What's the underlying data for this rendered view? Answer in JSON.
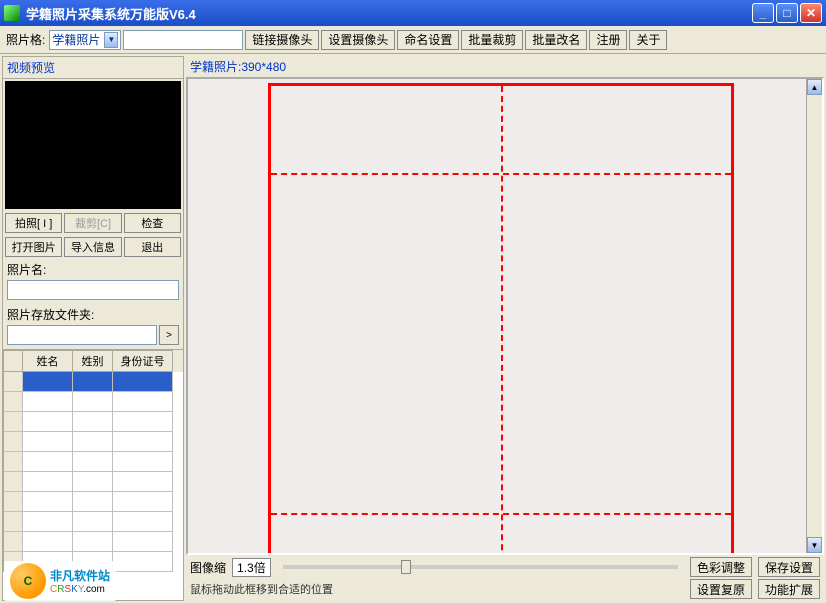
{
  "window": {
    "title": "学籍照片采集系统万能版V6.4"
  },
  "toolbar": {
    "format_label": "照片格:",
    "format_value": "学籍照片",
    "connect_cam": "链接摄像头",
    "set_cam": "设置摄像头",
    "name_set": "命名设置",
    "batch_crop": "批量裁剪",
    "batch_rename": "批量改名",
    "register": "注册",
    "about": "关于"
  },
  "left": {
    "preview_title": "视频预览",
    "btn_capture": "拍照[ I ]",
    "btn_crop": "裁剪[C]",
    "btn_check": "检查",
    "btn_open": "打开图片",
    "btn_import": "导入信息",
    "btn_exit": "退出",
    "photo_name_label": "照片名:",
    "folder_label": "照片存放文件夹:",
    "grid_headers": {
      "h1": "姓名",
      "h2": "姓别",
      "h3": "身份证号"
    }
  },
  "right": {
    "title": "学籍照片:390*480",
    "zoom_label": "图像缩",
    "zoom_value": "1.3倍",
    "hint": "鼠标拖动此框移到合适的位置",
    "btn_color": "色彩调整",
    "btn_save": "保存设置",
    "btn_restore": "设置复原",
    "btn_feature": "功能扩展"
  },
  "watermark": {
    "line1": "非凡软件站",
    "crsky": "CRSKY",
    "dotcom": ".com"
  }
}
